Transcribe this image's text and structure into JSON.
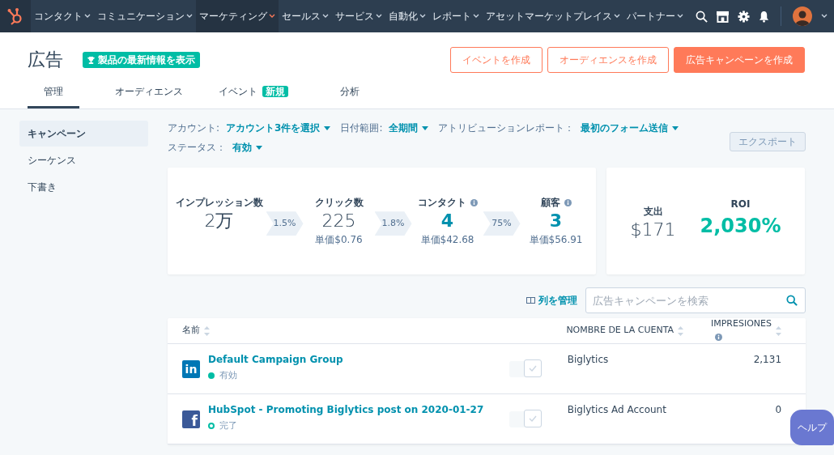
{
  "top_nav": {
    "items": [
      {
        "label": "コンタクト",
        "selected": false
      },
      {
        "label": "コミュニケーション",
        "selected": false
      },
      {
        "label": "マーケティング",
        "selected": true
      },
      {
        "label": "セールス",
        "selected": false
      },
      {
        "label": "サービス",
        "selected": false
      },
      {
        "label": "自動化",
        "selected": false
      },
      {
        "label": "レポート",
        "selected": false
      },
      {
        "label": "アセットマーケットプレイス",
        "selected": false
      },
      {
        "label": "パートナー",
        "selected": false
      }
    ]
  },
  "header": {
    "title": "広告",
    "whats_new_badge": "製品の最新情報を表示",
    "buttons": [
      {
        "label": "イベントを作成",
        "kind": "outline"
      },
      {
        "label": "オーディエンスを作成",
        "kind": "outline"
      },
      {
        "label": "広告キャンペーンを作成",
        "kind": "primary"
      }
    ]
  },
  "tabs": [
    {
      "label": "管理",
      "selected": true
    },
    {
      "label": "オーディエンス",
      "selected": false
    },
    {
      "label": "イベント",
      "selected": false,
      "badge": "新規"
    },
    {
      "label": "分析",
      "selected": false
    }
  ],
  "sidebar": {
    "items": [
      {
        "label": "キャンペーン",
        "selected": true
      },
      {
        "label": "シーケンス",
        "selected": false
      },
      {
        "label": "下書き",
        "selected": false
      }
    ]
  },
  "filters": [
    {
      "label": "アカウント:",
      "value": "アカウント3件を選択"
    },
    {
      "label": "日付範囲:",
      "value": "全期間"
    },
    {
      "label": "アトリビューションレポート：",
      "value": "最初のフォーム送信"
    },
    {
      "label": "ステータス：",
      "value": "有効"
    }
  ],
  "export_button": {
    "label": "エクスポート",
    "disabled": true
  },
  "funnel": {
    "steps": [
      {
        "label": "インプレッション数",
        "value": "2万",
        "highlight": false,
        "info": false
      },
      {
        "label": "クリック数",
        "value": "225",
        "unit_cost": "単価$0.76",
        "highlight": false,
        "info": false
      },
      {
        "label": "コンタクト",
        "value": "4",
        "unit_cost": "単価$42.68",
        "highlight": true,
        "info": true
      },
      {
        "label": "顧客",
        "value": "3",
        "unit_cost": "単価$56.91",
        "highlight": true,
        "info": true
      }
    ],
    "rates": [
      "1.5%",
      "1.8%",
      "75%"
    ]
  },
  "summary": {
    "spend_label": "支出",
    "spend": "$171",
    "roi_label": "ROI",
    "roi": "2,030%"
  },
  "table_tools": {
    "manage_columns": "列を管理",
    "search_placeholder": "広告キャンペーンを検索"
  },
  "table": {
    "columns": [
      {
        "label": "名前",
        "info": false
      },
      {
        "label": "NOMBRE DE LA CUENTA",
        "info": false
      },
      {
        "label": "IMPRESIONES",
        "info": true
      }
    ],
    "rows": [
      {
        "kind": "linkedin",
        "logo": "in",
        "name": "Default Campaign Group",
        "status": "有効",
        "status_active": true,
        "on": true,
        "account": "Biglytics",
        "impressions": "2,131"
      },
      {
        "kind": "facebook",
        "logo": "f",
        "name": "HubSpot - Promoting Biglytics post on 2020-01-27",
        "status": "完了",
        "status_active": false,
        "on": true,
        "account": "Biglytics Ad Account",
        "impressions": "0"
      }
    ]
  },
  "help_button": "ヘルプ"
}
